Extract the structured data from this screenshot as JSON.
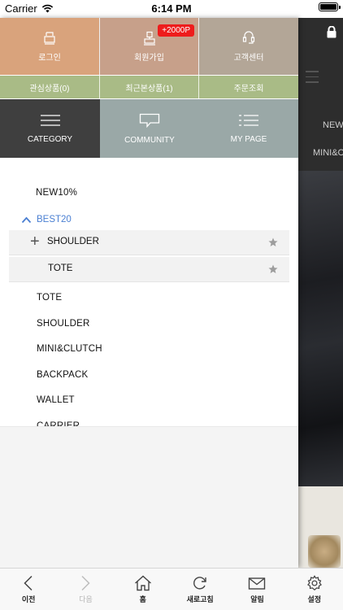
{
  "status_bar": {
    "carrier": "Carrier",
    "time": "6:14 PM",
    "battery_level": 1.0
  },
  "drawer": {
    "account_buttons": [
      {
        "label": "로그인",
        "icon": "login-icon",
        "color": "#d9a37c"
      },
      {
        "label": "회원가입",
        "icon": "join-member-icon",
        "color": "#c7a08a",
        "badge": "+2000P"
      },
      {
        "label": "고객센터",
        "icon": "customer-service-icon",
        "color": "#b3a697"
      }
    ],
    "quick_links": [
      {
        "label": "관심상품(0)"
      },
      {
        "label": "최근본상품(1)"
      },
      {
        "label": "주문조회"
      }
    ],
    "tabs": [
      {
        "label": "CATEGORY",
        "icon": "hamburger-icon",
        "color": "#3f3f3f"
      },
      {
        "label": "COMMUNITY",
        "icon": "speech-bubble-icon",
        "color": "#9aa8a7"
      },
      {
        "label": "MY PAGE",
        "icon": "list-icon",
        "color": "#9aa8a7"
      }
    ],
    "categories": {
      "new": "NEW10%",
      "best": "BEST20",
      "best_subitems": [
        {
          "label": "SHOULDER",
          "expand": "+"
        },
        {
          "label": "TOTE"
        }
      ],
      "items": [
        "TOTE",
        "SHOULDER",
        "MINI&CLUTCH",
        "BACKPACK",
        "WALLET",
        "CARRIER"
      ]
    }
  },
  "background_page": {
    "nav_items": [
      "NEW",
      "MINI&C"
    ]
  },
  "toolbar": {
    "items": [
      {
        "label": "이전",
        "icon": "back-arrow-icon",
        "enabled": true
      },
      {
        "label": "다음",
        "icon": "forward-arrow-icon",
        "enabled": false
      },
      {
        "label": "홈",
        "icon": "home-icon",
        "enabled": true
      },
      {
        "label": "새로고침",
        "icon": "refresh-icon",
        "enabled": true
      },
      {
        "label": "알림",
        "icon": "mail-icon",
        "enabled": true
      },
      {
        "label": "설정",
        "icon": "settings-gear-icon",
        "enabled": true
      }
    ]
  }
}
